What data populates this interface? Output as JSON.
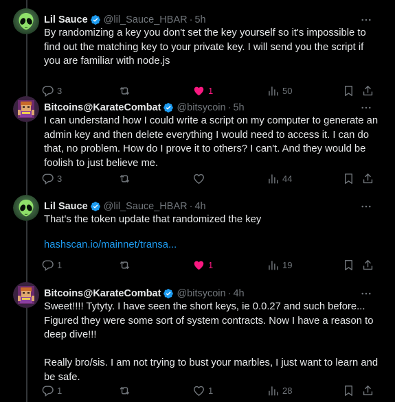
{
  "tweets": [
    {
      "name": "Lil Sauce",
      "handle": "@lil_Sauce_HBAR",
      "separator": "·",
      "time": "5h",
      "text": "By randomizing a key you don't set the key yourself so it's impossible to find out the matching key to your private key. I will send you the script if you are familiar with node.js",
      "link": "",
      "replies": "3",
      "reposts": "",
      "likes": "1",
      "liked": true,
      "views": "50",
      "avatar": "alien-avatar"
    },
    {
      "name": "Bitcoins@KarateCombat",
      "handle": "@bitsycoin",
      "separator": "·",
      "time": "5h",
      "text": "I can understand how I could write a script on my computer to generate an admin key and then delete everything I would need to access it.  I can do that, no problem.  How do I prove it to others? I can't. And they would be foolish to just believe me.",
      "link": "",
      "replies": "3",
      "reposts": "",
      "likes": "",
      "liked": false,
      "views": "44",
      "avatar": "pixel-avatar"
    },
    {
      "name": "Lil Sauce",
      "handle": "@lil_Sauce_HBAR",
      "separator": "·",
      "time": "4h",
      "text": "That's the token update that randomized the key",
      "link": "hashscan.io/mainnet/transa...",
      "replies": "1",
      "reposts": "",
      "likes": "1",
      "liked": true,
      "views": "19",
      "avatar": "alien-avatar"
    },
    {
      "name": "Bitcoins@KarateCombat",
      "handle": "@bitsycoin",
      "separator": "·",
      "time": "4h",
      "text": "Sweet!!!! Tytyty. I have seen the short keys, ie 0.0.27 and such before... Figured they were some sort of system contracts. Now I have a reason to deep dive!!!\n\nReally bro/sis. I am not trying to bust your marbles, I just want to learn and be safe.",
      "link": "",
      "replies": "1",
      "reposts": "",
      "likes": "1",
      "liked": false,
      "views": "28",
      "avatar": "pixel-avatar"
    }
  ],
  "icons": {
    "more": "more-dots-icon",
    "reply": "reply-bubble-icon",
    "repost": "repost-arrows-icon",
    "like": "heart-icon",
    "views": "views-bars-icon",
    "bookmark": "bookmark-icon",
    "share": "share-upload-icon",
    "verified": "verified-badge-icon"
  },
  "colors": {
    "background": "#000000",
    "text": "#e7e9ea",
    "muted": "#71767b",
    "link": "#1d9bf0",
    "like": "#f91880",
    "verified": "#1d9bf0"
  }
}
